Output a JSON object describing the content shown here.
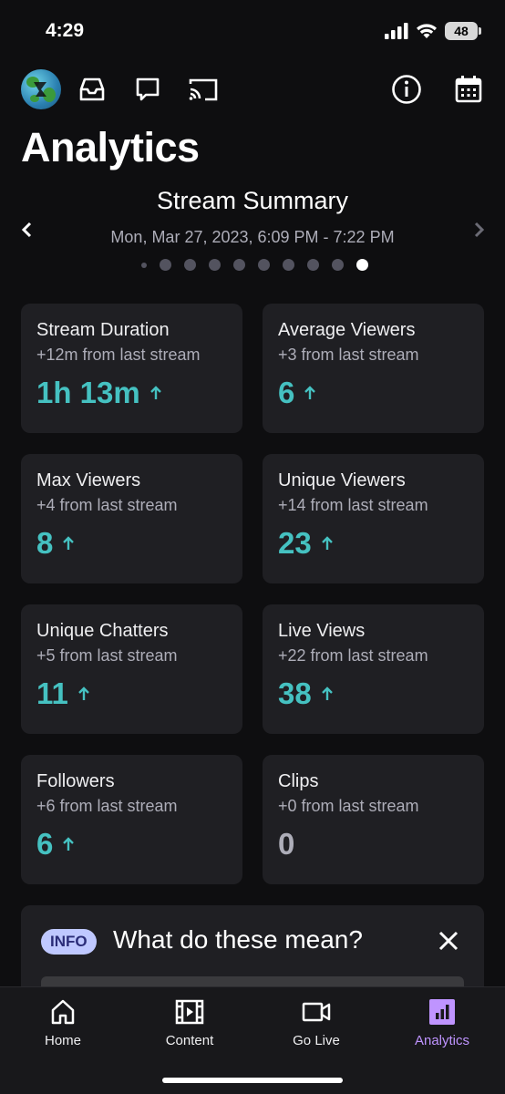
{
  "status_bar": {
    "time": "4:29",
    "battery": "48"
  },
  "page": {
    "title": "Analytics"
  },
  "summary": {
    "title": "Stream Summary",
    "date_range": "Mon, Mar 27, 2023, 6:09 PM - 7:22 PM",
    "page_count": 10,
    "active_page": 10
  },
  "cards": [
    {
      "title": "Stream Duration",
      "sub": "+12m from last stream",
      "value": "1h 13m",
      "trend": "up"
    },
    {
      "title": "Average Viewers",
      "sub": "+3 from last stream",
      "value": "6",
      "trend": "up"
    },
    {
      "title": "Max Viewers",
      "sub": "+4 from last stream",
      "value": "8",
      "trend": "up"
    },
    {
      "title": "Unique Viewers",
      "sub": "+14 from last stream",
      "value": "23",
      "trend": "up"
    },
    {
      "title": "Unique Chatters",
      "sub": "+5 from last stream",
      "value": "11",
      "trend": "up"
    },
    {
      "title": "Live Views",
      "sub": "+22 from last stream",
      "value": "38",
      "trend": "up"
    },
    {
      "title": "Followers",
      "sub": "+6 from last stream",
      "value": "6",
      "trend": "up"
    },
    {
      "title": "Clips",
      "sub": "+0 from last stream",
      "value": "0",
      "trend": "none"
    }
  ],
  "info": {
    "badge": "INFO",
    "title": "What do these mean?"
  },
  "tabs": [
    {
      "label": "Home",
      "icon": "home-icon",
      "active": false
    },
    {
      "label": "Content",
      "icon": "film-icon",
      "active": false
    },
    {
      "label": "Go Live",
      "icon": "camera-icon",
      "active": false
    },
    {
      "label": "Analytics",
      "icon": "bar-chart-icon",
      "active": true
    }
  ],
  "colors": {
    "accent": "#45c1c1",
    "active_tab": "#bf94ff",
    "card_bg": "#1f1f23",
    "background": "#0e0e10"
  }
}
